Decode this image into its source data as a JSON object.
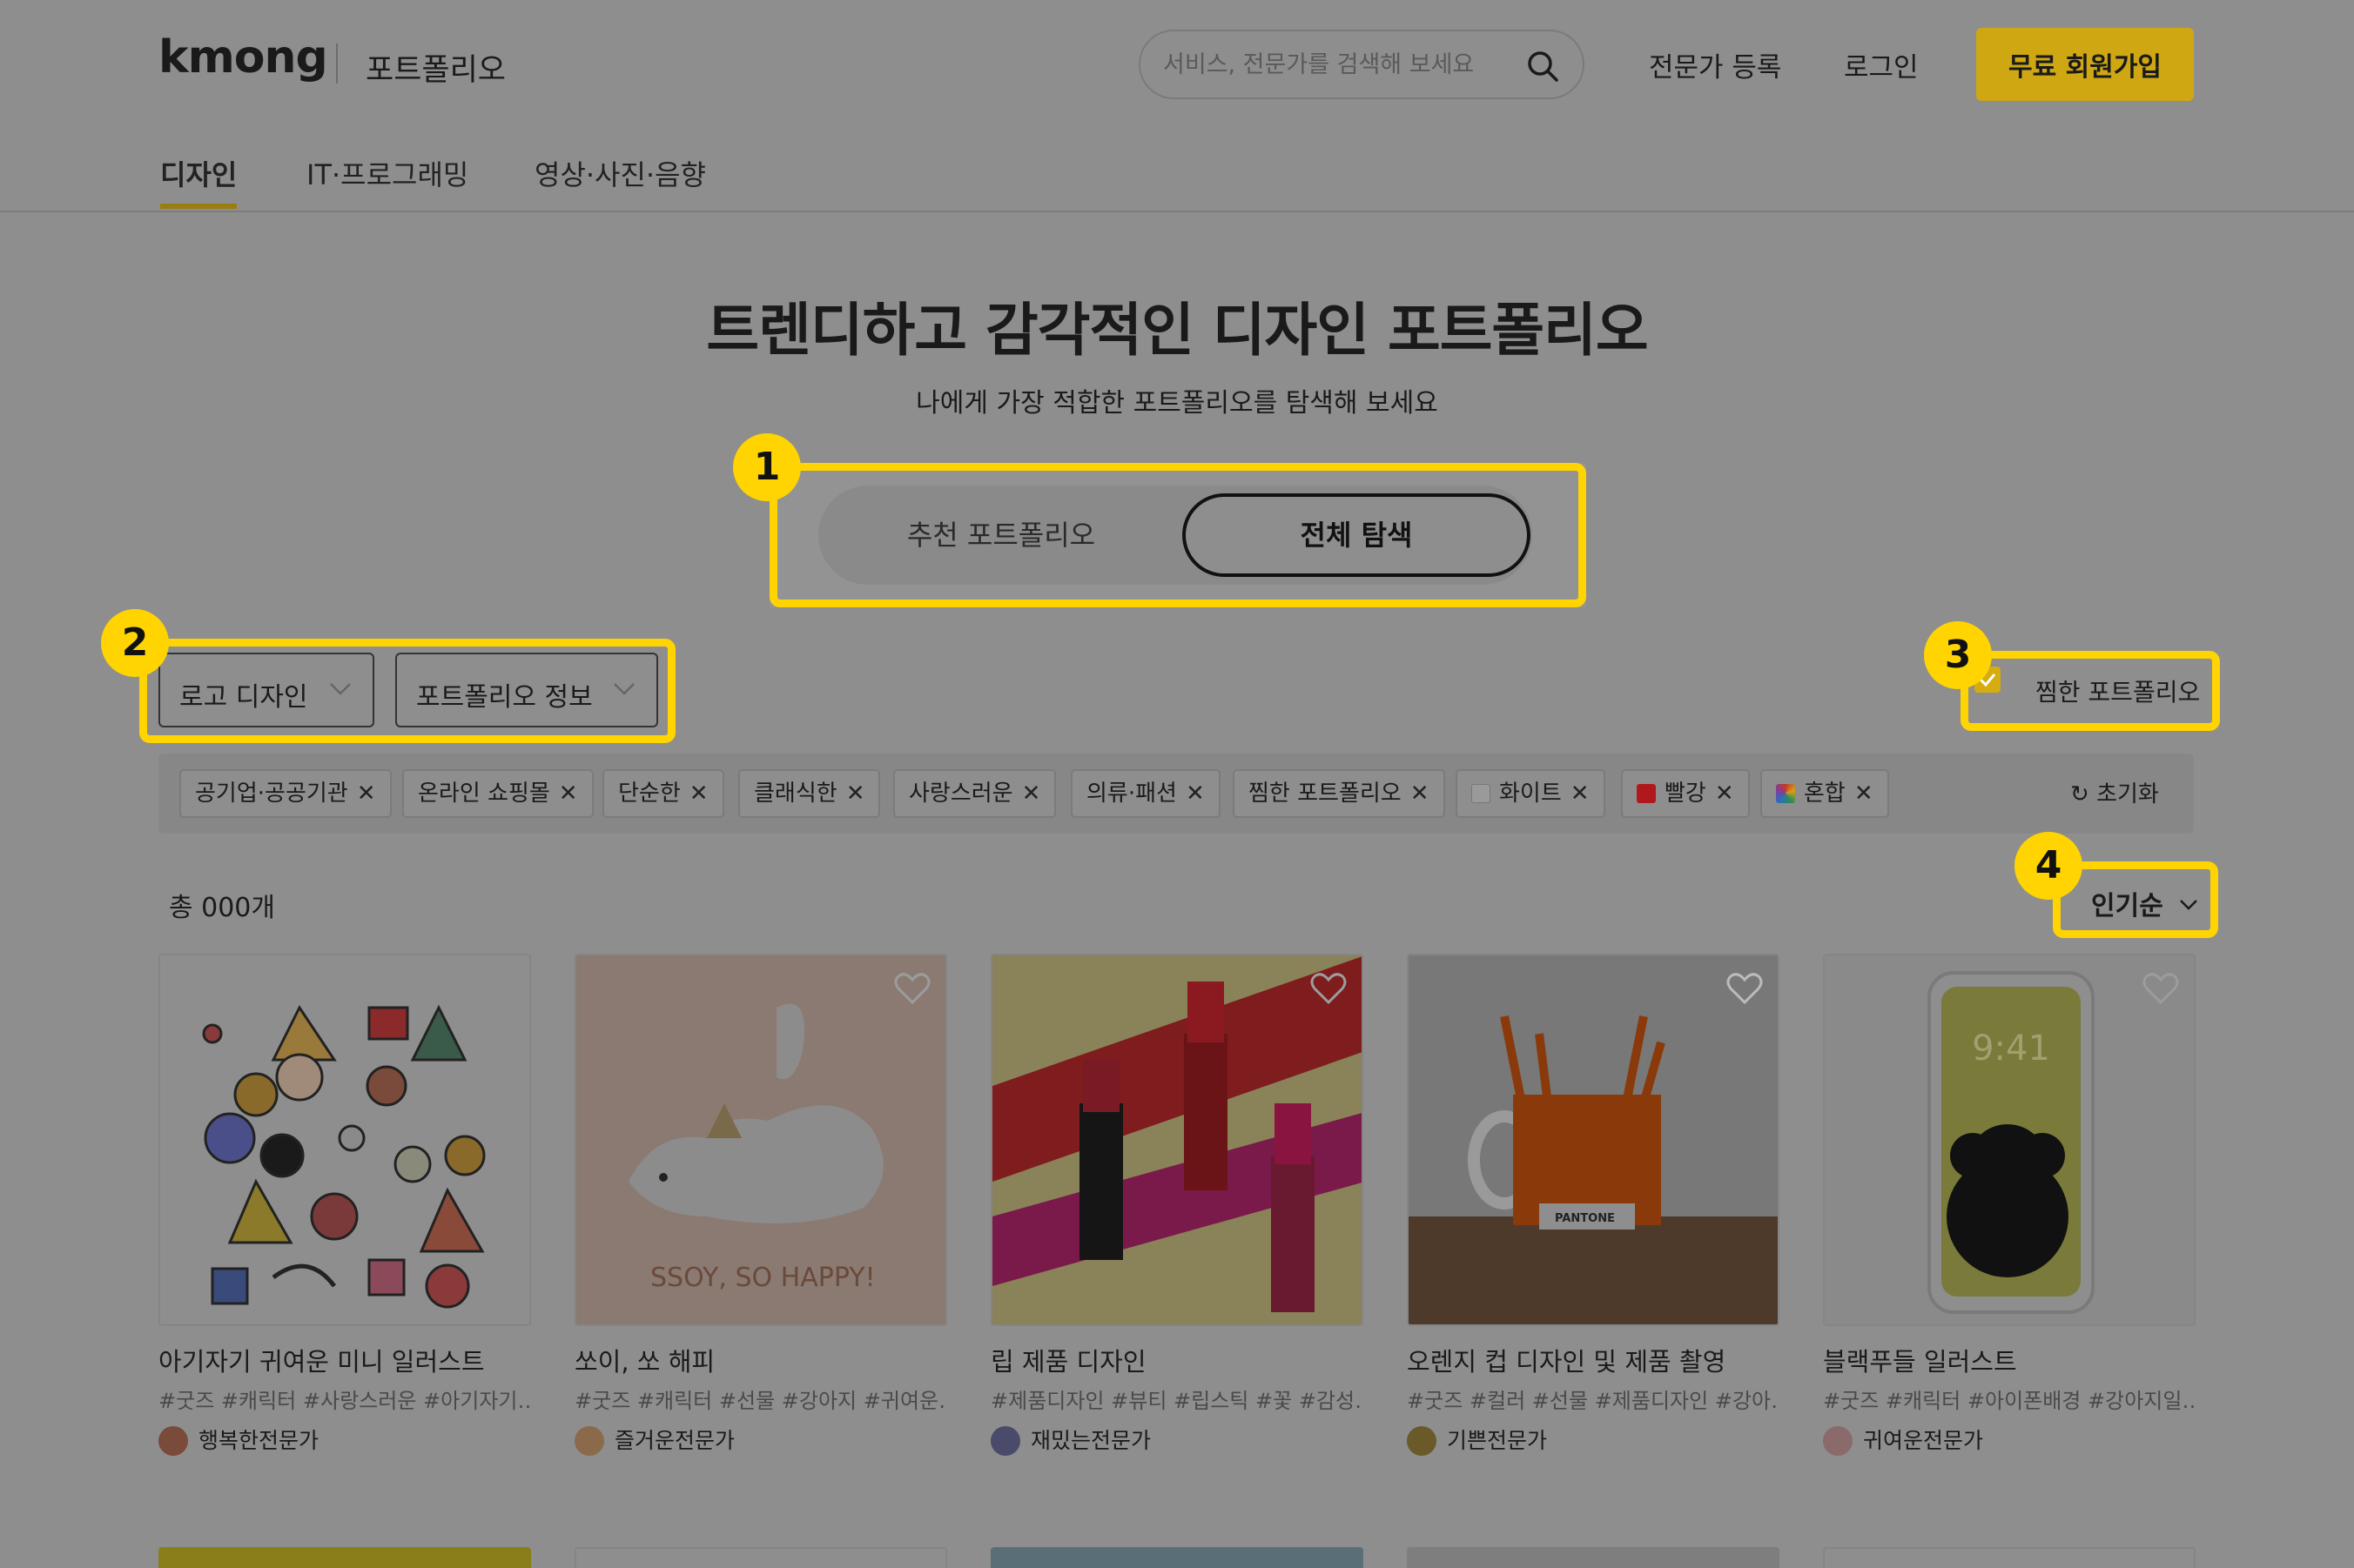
{
  "header": {
    "logo": "kmong",
    "section": "포트폴리오",
    "search_placeholder": "서비스, 전문가를 검색해 보세요",
    "expert_register": "전문가 등록",
    "login": "로그인",
    "signup": "무료 회원가입"
  },
  "tabs": [
    "디자인",
    "IT·프로그래밍",
    "영상·사진·음향"
  ],
  "hero": {
    "title": "트렌디하고 감각적인 디자인 포트폴리오",
    "subtitle": "나에게 가장 적합한 포트폴리오를 탐색해 보세요"
  },
  "toggle": {
    "recommended": "추천 포트폴리오",
    "explore_all": "전체 탐색"
  },
  "filters": {
    "category": "로고 디자인",
    "portfolio_info": "포트폴리오 정보",
    "favorites_label": "찜한 포트폴리오",
    "reset": "초기화"
  },
  "chips": [
    {
      "label": "공기업·공공기관"
    },
    {
      "label": "온라인 쇼핑몰"
    },
    {
      "label": "단순한"
    },
    {
      "label": "클래식한"
    },
    {
      "label": "사랑스러운"
    },
    {
      "label": "의류·패션"
    },
    {
      "label": "찜한 포트폴리오"
    },
    {
      "label": "화이트",
      "swatch": "#9a9a9a"
    },
    {
      "label": "빨강",
      "swatch": "#b0191c"
    },
    {
      "label": "혼합",
      "swatch": "mixed"
    }
  ],
  "callouts": [
    "1",
    "2",
    "3",
    "4"
  ],
  "results": {
    "total": "총 000개",
    "sort": "인기순"
  },
  "cards": [
    {
      "title": "아기자기 귀여운 미니 일러스트",
      "tags": "#굿즈 #캐릭터 #사랑스러운 #아기자기…",
      "author": "행복한전문가"
    },
    {
      "title": "쏘이, 쏘 해피",
      "tags": "#굿즈 #캐릭터 #선물 #강아지 #귀여운…",
      "author": "즐거운전문가",
      "image_text": "SSOY, SO HAPPY!"
    },
    {
      "title": "립 제품 디자인",
      "tags": "#제품디자인 #뷰티 #립스틱 #꽃 #감성…",
      "author": "재밌는전문가"
    },
    {
      "title": "오렌지 컵 디자인 및 제품 촬영",
      "tags": "#굿즈 #컬러 #선물 #제품디자인 #강아…",
      "author": "기쁜전문가",
      "image_text": "PANTONE"
    },
    {
      "title": "블랙푸들 일러스트",
      "tags": "#굿즈 #캐릭터 #아이폰배경 #강아지일…",
      "author": "귀여운전문가",
      "image_text": "9:41"
    }
  ],
  "colors": {
    "accent": "#ffd400",
    "signup_bg": "#cfa712",
    "overlay_bg": "#8e8e8e"
  }
}
